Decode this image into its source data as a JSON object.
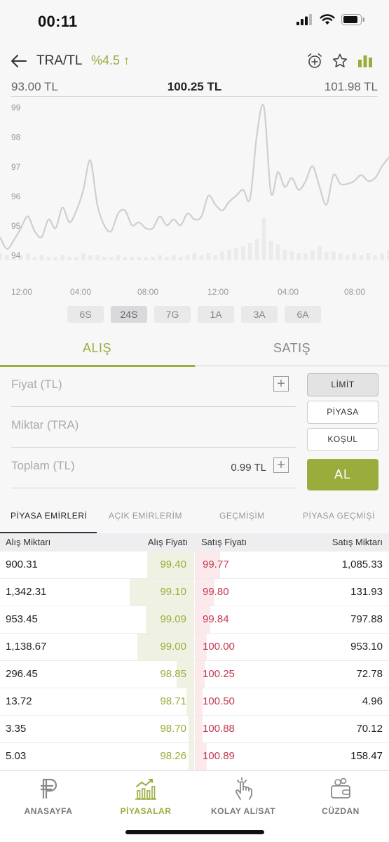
{
  "status": {
    "time": "00:11"
  },
  "header": {
    "pair": "TRA/TL",
    "change": "%4.5 ↑",
    "icons": [
      "back-arrow-icon",
      "alarm-add-icon",
      "star-icon",
      "bar-chart-icon"
    ],
    "accent": "#9aad3c"
  },
  "prices": {
    "low": "93.00 TL",
    "current": "100.25 TL",
    "high": "101.98 TL"
  },
  "chart_data": {
    "type": "line",
    "title": "",
    "xlabel": "",
    "ylabel": "",
    "y_ticks": [
      "99",
      "98",
      "97",
      "96",
      "95",
      "94"
    ],
    "x_ticks": [
      "12:00",
      "04:00",
      "08:00",
      "12:00",
      "04:00",
      "08:00"
    ],
    "ylim": [
      93.6,
      99.3
    ],
    "grid": false,
    "series": [
      {
        "values": [
          94.6,
          94.2,
          94.5,
          94.9,
          95.3,
          94.8,
          94.6,
          95.2,
          94.9,
          95.6,
          95.1,
          95.5,
          96.2,
          97.2,
          95.7,
          95.0,
          94.8,
          95.4,
          95.5,
          95.0,
          95.1,
          94.9,
          94.9,
          95.3,
          95.0,
          95.2,
          95.0,
          95.4,
          95.2,
          95.3,
          96.0,
          95.7,
          95.5,
          95.8,
          96.0,
          96.2,
          95.9,
          98.1,
          99.0,
          96.1,
          96.8,
          96.3,
          96.6,
          96.2,
          96.5,
          97.0,
          96.3,
          95.7,
          96.7,
          96.4,
          96.4,
          96.5,
          96.7,
          96.5,
          96.6,
          97.0,
          97.3
        ],
        "volume": [
          4,
          3,
          2,
          3,
          4,
          2,
          3,
          2,
          2,
          3,
          2,
          2,
          4,
          3,
          3,
          2,
          2,
          3,
          2,
          2,
          2,
          2,
          2,
          3,
          2,
          3,
          2,
          3,
          4,
          3,
          4,
          3,
          5,
          6,
          7,
          8,
          10,
          12,
          24,
          11,
          9,
          6,
          5,
          4,
          4,
          6,
          8,
          5,
          5,
          4,
          3,
          4,
          3,
          4,
          3,
          4,
          6
        ]
      }
    ]
  },
  "range_tabs": [
    "6S",
    "24S",
    "7G",
    "1A",
    "3A",
    "6A"
  ],
  "range_active": "24S",
  "order_tabs": {
    "buy": "ALIŞ",
    "sell": "SATIŞ"
  },
  "form": {
    "price_label": "Fiyat (TL)",
    "amount_label": "Miktar (TRA)",
    "total_label": "Toplam (TL)",
    "total_value": "0.99 TL"
  },
  "order_types": [
    "LİMİT",
    "PİYASA",
    "KOŞUL"
  ],
  "submit_label": "AL",
  "market_tabs": [
    "PİYASA EMİRLERİ",
    "AÇIK EMİRLERİM",
    "GEÇMİŞİM",
    "PİYASA GEÇMİŞİ"
  ],
  "book": {
    "headers": {
      "buy_amount": "Alış Miktarı",
      "buy_price": "Alış Fiyatı",
      "sell_price": "Satış Fiyatı",
      "sell_amount": "Satış Miktarı"
    },
    "rows": [
      {
        "buy_amount": "900.31",
        "buy_price": "99.40",
        "sell_price": "99.77",
        "sell_amount": "1,085.33",
        "buy_depth": 0.24,
        "sell_depth": 0.13
      },
      {
        "buy_amount": "1,342.31",
        "buy_price": "99.10",
        "sell_price": "99.80",
        "sell_amount": "131.93",
        "buy_depth": 0.33,
        "sell_depth": 0.1
      },
      {
        "buy_amount": "953.45",
        "buy_price": "99.09",
        "sell_price": "99.84",
        "sell_amount": "797.88",
        "buy_depth": 0.25,
        "sell_depth": 0.08
      },
      {
        "buy_amount": "1,138.67",
        "buy_price": "99.00",
        "sell_price": "100.00",
        "sell_amount": "953.10",
        "buy_depth": 0.29,
        "sell_depth": 0.06
      },
      {
        "buy_amount": "296.45",
        "buy_price": "98.85",
        "sell_price": "100.25",
        "sell_amount": "72.78",
        "buy_depth": 0.09,
        "sell_depth": 0.05
      },
      {
        "buy_amount": "13.72",
        "buy_price": "98.71",
        "sell_price": "100.50",
        "sell_amount": "4.96",
        "buy_depth": 0.04,
        "sell_depth": 0.04
      },
      {
        "buy_amount": "3.35",
        "buy_price": "98.70",
        "sell_price": "100.88",
        "sell_amount": "70.12",
        "buy_depth": 0.03,
        "sell_depth": 0.04
      },
      {
        "buy_amount": "5.03",
        "buy_price": "98.26",
        "sell_price": "100.89",
        "sell_amount": "158.47",
        "buy_depth": 0.03,
        "sell_depth": 0.06
      }
    ],
    "buy_color": "#9aad3c",
    "sell_color": "#c2384f"
  },
  "nav": [
    {
      "label": "ANASAYFA",
      "icon": "home-p-icon"
    },
    {
      "label": "PİYASALAR",
      "icon": "markets-icon"
    },
    {
      "label": "KOLAY AL/SAT",
      "icon": "easy-trade-icon"
    },
    {
      "label": "CÜZDAN",
      "icon": "wallet-icon"
    }
  ],
  "nav_active": "PİYASALAR"
}
